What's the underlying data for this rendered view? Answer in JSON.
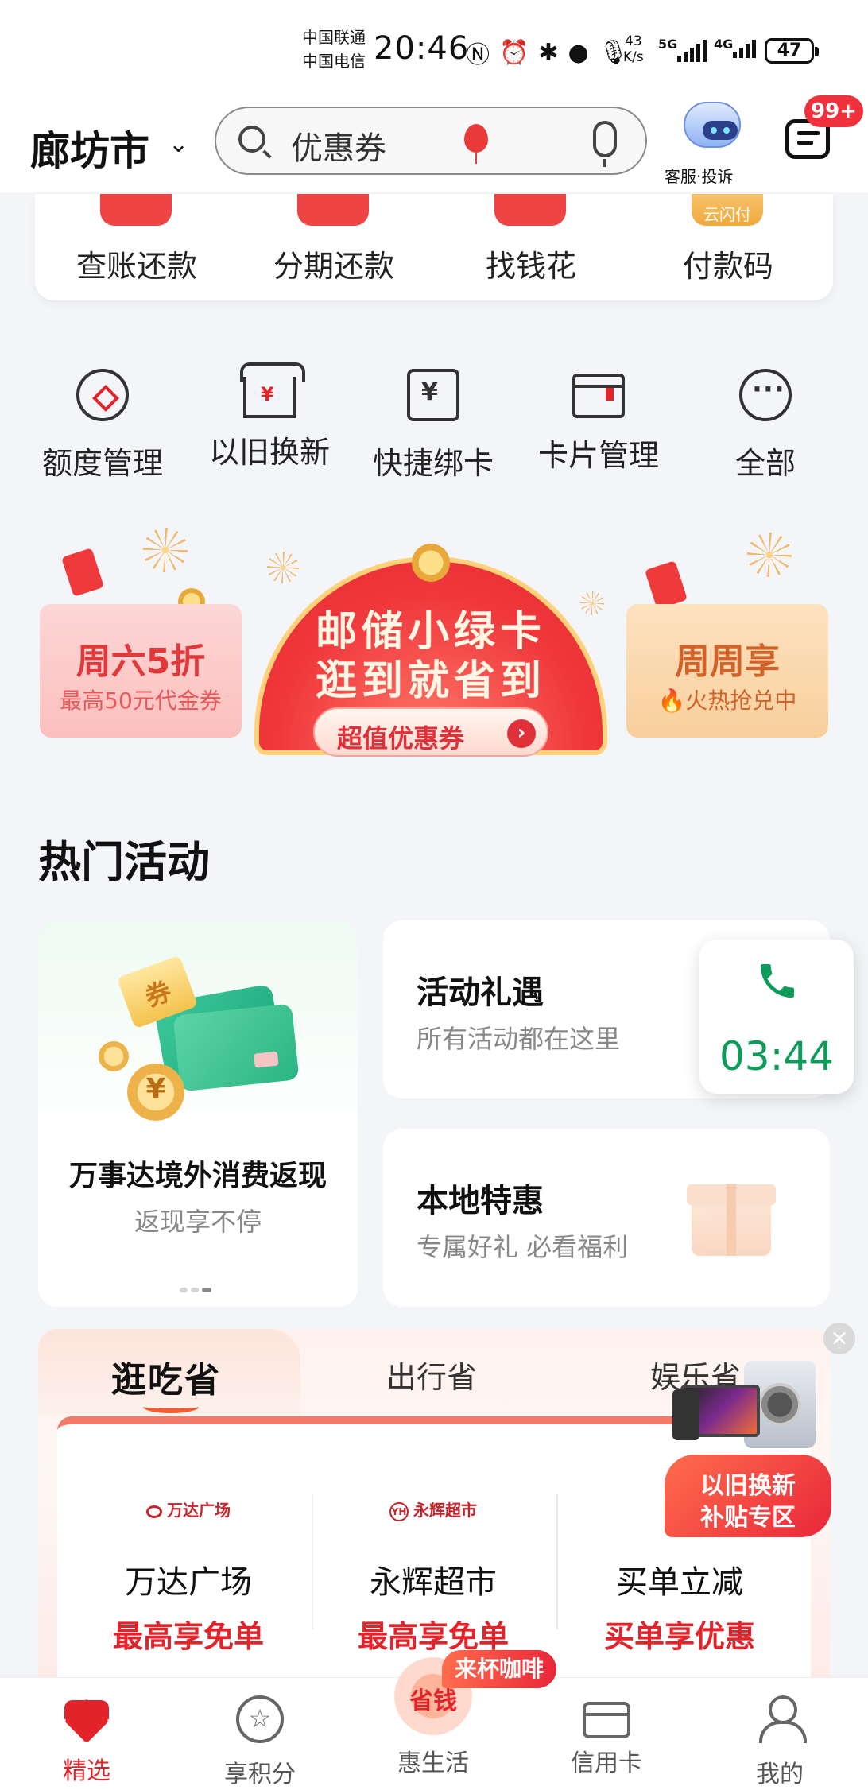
{
  "status_bar": {
    "carrier_1": "中国联通",
    "carrier_2": "中国电信",
    "time": "20:46",
    "speed_value": "43",
    "speed_unit": "K/s",
    "net_1": "5G",
    "net_2": "4G",
    "battery": "47"
  },
  "header": {
    "city": "廊坊市",
    "search_placeholder": "优惠券",
    "service_label": "客服·投诉",
    "message_badge": "99+"
  },
  "quick_actions": [
    {
      "label": "查账还款"
    },
    {
      "label": "分期还款"
    },
    {
      "label": "找钱花"
    },
    {
      "label": "付款码",
      "stub_text": "云闪付"
    }
  ],
  "services": [
    {
      "label": "额度管理",
      "icon": "diamond-circle-icon"
    },
    {
      "label": "以旧换新",
      "icon": "storefront-icon"
    },
    {
      "label": "快捷绑卡",
      "icon": "bind-card-icon"
    },
    {
      "label": "卡片管理",
      "icon": "wallet-icon"
    },
    {
      "label": "全部",
      "icon": "more-icon"
    }
  ],
  "promo": {
    "left_title": "周六5折",
    "left_sub": "最高50元代金券",
    "center_line1": "邮储小绿卡",
    "center_line2": "逛到就省到",
    "center_button": "超值优惠券",
    "right_title": "周周享",
    "right_sub": "火热抢兑中"
  },
  "hot": {
    "title": "热门活动",
    "big_card": {
      "title": "万事达境外消费返现",
      "sub": "返现享不停",
      "ticket": "券"
    },
    "cards": [
      {
        "title": "活动礼遇",
        "sub": "所有活动都在这里"
      },
      {
        "title": "本地特惠",
        "sub": "专属好礼 必看福利"
      }
    ]
  },
  "call": {
    "time": "03:44"
  },
  "save_section": {
    "tabs": [
      "逛吃省",
      "出行省",
      "娱乐省"
    ],
    "merchants": [
      {
        "logo": "万达广场",
        "name": "万达广场",
        "offer": "最高享免单"
      },
      {
        "logo": "永辉超市",
        "name": "永辉超市",
        "offer": "最高享免单"
      },
      {
        "logo": "",
        "name": "买单立减",
        "offer": "买单享优惠"
      }
    ],
    "trade_in_line1": "以旧换新",
    "trade_in_line2": "补贴专区"
  },
  "bottom_nav": [
    {
      "label": "精选",
      "active": true
    },
    {
      "label": "享积分"
    },
    {
      "label": "惠生活",
      "center": "省钱",
      "tag": "来杯咖啡"
    },
    {
      "label": "信用卡"
    },
    {
      "label": "我的"
    }
  ],
  "colors": {
    "accent": "#e2232a",
    "call_green": "#0c9c5a",
    "badge": "#f0313b"
  }
}
